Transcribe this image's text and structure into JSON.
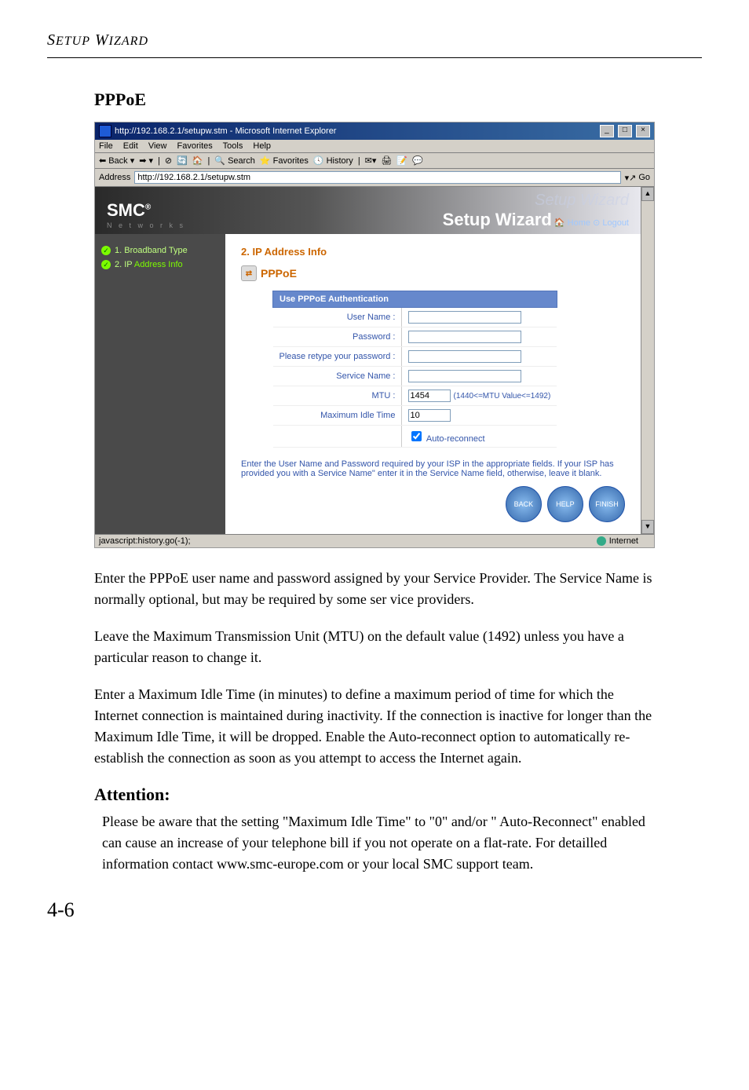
{
  "header": "Setup Wizard",
  "section_title": "PPPoE",
  "browser": {
    "title": "http://192.168.2.1/setupw.stm - Microsoft Internet Explorer",
    "menu": {
      "file": "File",
      "edit": "Edit",
      "view": "View",
      "favorites": "Favorites",
      "tools": "Tools",
      "help": "Help"
    },
    "toolbar": {
      "back": "Back",
      "search": "Search",
      "favorites": "Favorites",
      "history": "History"
    },
    "address_label": "Address",
    "address_value": "http://192.168.2.1/setupw.stm",
    "go_label": "Go",
    "status_left": "javascript:history.go(-1);",
    "status_right": "Internet"
  },
  "banner": {
    "logo": "SMC",
    "reg": "®",
    "networks": "N e t w o r k s",
    "faded": "Setup Wizard",
    "main": "Setup Wizard",
    "home": "Home",
    "logout": "Logout"
  },
  "sidebar": {
    "item1": "1. Broadband Type",
    "item2_a": "2. IP ",
    "item2_b": "Address Info"
  },
  "form": {
    "ip_title": "2. IP Address Info",
    "pppoe": "PPPoE",
    "auth_header": "Use PPPoE Authentication",
    "user_name": "User Name :",
    "password": "Password :",
    "retype": "Please retype your password :",
    "service": "Service Name :",
    "mtu": "MTU :",
    "mtu_value": "1454",
    "mtu_hint": "(1440<=MTU Value<=1492)",
    "idle": "Maximum Idle Time",
    "idle_value": "10",
    "auto": "Auto-reconnect",
    "note": "Enter the User Name and Password required by your ISP in the appropriate fields. If your ISP has provided you with a Service Name\" enter it in the Service Name field, otherwise, leave it blank.",
    "back": "BACK",
    "help": "HELP",
    "finish": "FINISH"
  },
  "body": {
    "p1": "Enter the PPPoE user name and password assigned by your Service Provider. The Service Name is normally optional, but may be required by some ser vice providers.",
    "p2": "Leave the Maximum Transmission Unit (MTU) on the default value (1492) unless you have a particular reason to change it.",
    "p3": "Enter a Maximum Idle Time (in minutes) to define a maximum period of time for which the Internet connection is maintained during inactivity.  If the connection is inactive for longer than the Maximum Idle Time, it will be dropped.  Enable the Auto-reconnect option to automatically re-establish the connection as soon as you attempt to access the Internet again.",
    "attention_h": "Attention:",
    "attention_p": "Please be aware that the setting \"Maximum Idle Time\" to \"0\" and/or \" Auto-Reconnect\" enabled can cause an increase of your telephone bill if you not operate on a flat-rate. For detailled information contact www.smc-europe.com or your local SMC support team."
  },
  "page_number": "4-6"
}
